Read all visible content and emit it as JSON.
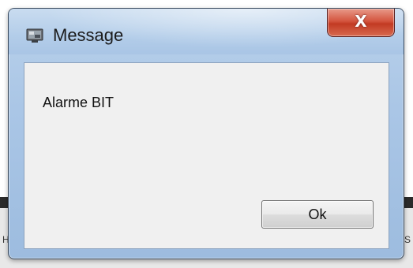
{
  "window": {
    "title": "Message",
    "icon": "app-icon",
    "close_icon": "close-icon",
    "close_glyph": "X"
  },
  "content": {
    "message": "Alarme BIT"
  },
  "buttons": {
    "ok_label": "Ok"
  },
  "background": {
    "left_glyph": "H",
    "right_glyph": "S"
  },
  "colors": {
    "close_button": "#c23a23",
    "frame": "#aac6e6",
    "client": "#f0f0f0"
  }
}
